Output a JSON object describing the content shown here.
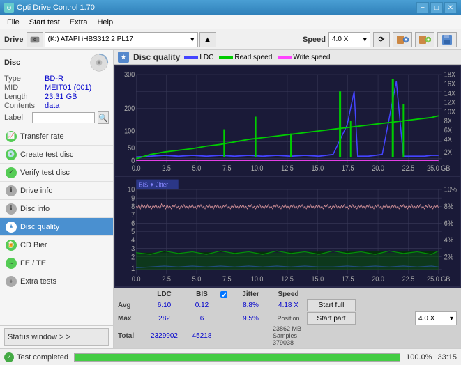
{
  "app": {
    "title": "Opti Drive Control 1.70",
    "icon": "cd-icon"
  },
  "title_controls": {
    "minimize": "−",
    "maximize": "□",
    "close": "✕"
  },
  "menu": {
    "items": [
      "File",
      "Start test",
      "Extra",
      "Help"
    ]
  },
  "toolbar": {
    "drive_label": "Drive",
    "drive_value": "(K:)  ATAPI iHBS312  2 PL17",
    "speed_label": "Speed",
    "speed_value": "4.0 X"
  },
  "disc": {
    "title": "Disc",
    "type_label": "Type",
    "type_value": "BD-R",
    "mid_label": "MID",
    "mid_value": "MEIT01 (001)",
    "length_label": "Length",
    "length_value": "23.31 GB",
    "contents_label": "Contents",
    "contents_value": "data",
    "label_label": "Label",
    "label_placeholder": ""
  },
  "nav": {
    "items": [
      {
        "id": "transfer-rate",
        "label": "Transfer rate",
        "icon": "chart-icon"
      },
      {
        "id": "create-test-disc",
        "label": "Create test disc",
        "icon": "disc-icon"
      },
      {
        "id": "verify-test-disc",
        "label": "Verify test disc",
        "icon": "check-icon"
      },
      {
        "id": "drive-info",
        "label": "Drive info",
        "icon": "info-icon"
      },
      {
        "id": "disc-info",
        "label": "Disc info",
        "icon": "disc-info-icon"
      },
      {
        "id": "disc-quality",
        "label": "Disc quality",
        "icon": "quality-icon",
        "active": true
      },
      {
        "id": "cd-bier",
        "label": "CD Bier",
        "icon": "beer-icon"
      },
      {
        "id": "fe-te",
        "label": "FE / TE",
        "icon": "fe-icon"
      },
      {
        "id": "extra-tests",
        "label": "Extra tests",
        "icon": "extra-icon"
      }
    ],
    "status_window": "Status window > >"
  },
  "disc_quality": {
    "title": "Disc quality",
    "legend": {
      "ldc": "LDC",
      "read_speed": "Read speed",
      "write_speed": "Write speed"
    },
    "chart1": {
      "y_max": 300,
      "y_axis_labels": [
        "300",
        "200",
        "100",
        "50",
        "0"
      ],
      "y_axis_right": [
        "18X",
        "16X",
        "14X",
        "12X",
        "10X",
        "8X",
        "6X",
        "4X",
        "2X"
      ],
      "x_axis_labels": [
        "0.0",
        "2.5",
        "5.0",
        "7.5",
        "10.0",
        "12.5",
        "15.0",
        "17.5",
        "20.0",
        "22.5",
        "25.0 GB"
      ]
    },
    "chart2": {
      "title": "BIS ☆ Jitter",
      "y_axis_labels": [
        "10",
        "9",
        "8",
        "7",
        "6",
        "5",
        "4",
        "3",
        "2",
        "1"
      ],
      "y_axis_right": [
        "10%",
        "8%",
        "6%",
        "4%",
        "2%"
      ],
      "x_axis_labels": [
        "0.0",
        "2.5",
        "5.0",
        "7.5",
        "10.0",
        "12.5",
        "15.0",
        "17.5",
        "20.0",
        "22.5",
        "25.0 GB"
      ]
    }
  },
  "stats": {
    "columns": [
      "",
      "LDC",
      "BIS",
      "",
      "Jitter",
      "Speed",
      ""
    ],
    "avg_label": "Avg",
    "max_label": "Max",
    "total_label": "Total",
    "ldc_avg": "6.10",
    "ldc_max": "282",
    "ldc_total": "2329902",
    "bis_avg": "0.12",
    "bis_max": "6",
    "bis_total": "45218",
    "jitter_avg": "8.8%",
    "jitter_max": "9.5%",
    "jitter_total": "",
    "speed_label": "Speed",
    "speed_value": "4.18 X",
    "speed_dropdown": "4.0 X",
    "position_label": "Position",
    "position_value": "23862 MB",
    "samples_label": "Samples",
    "samples_value": "379038",
    "jitter_checked": true,
    "jitter_check_label": "Jitter"
  },
  "buttons": {
    "start_full": "Start full",
    "start_part": "Start part"
  },
  "status_bar": {
    "status_text": "Test completed",
    "progress": 100,
    "progress_display": "100.0%",
    "time": "33:15"
  }
}
